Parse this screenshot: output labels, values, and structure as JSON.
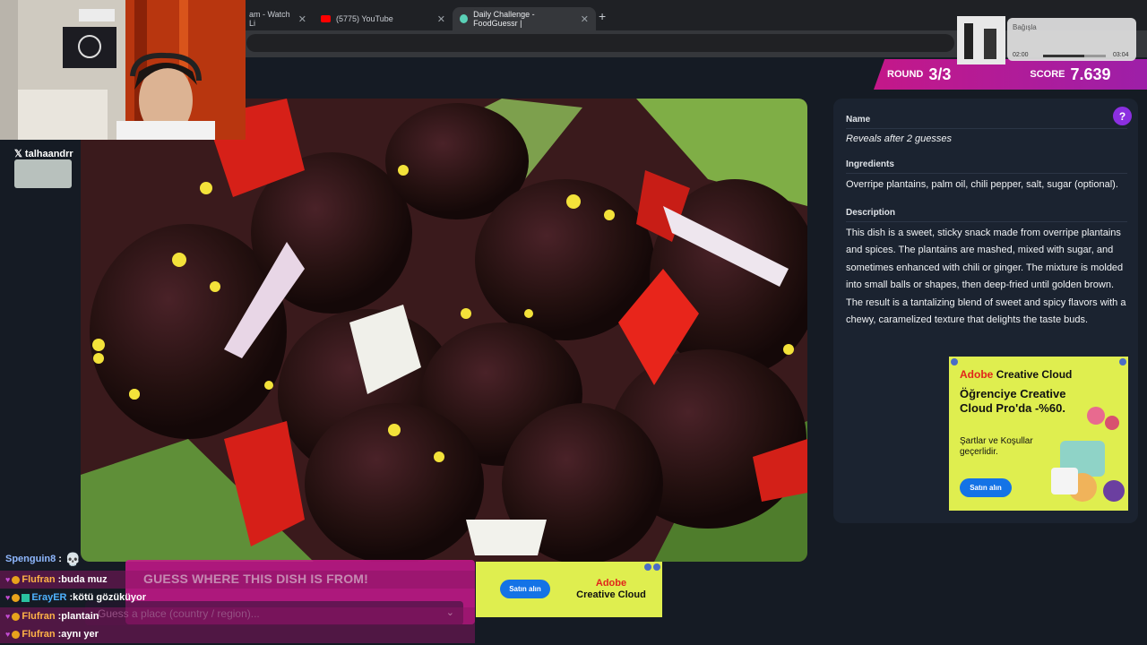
{
  "browser": {
    "tabs": [
      {
        "label": "am - Watch Li"
      },
      {
        "label": "(5775) YouTube"
      },
      {
        "label": "Daily Challenge - FoodGuessr |"
      }
    ],
    "new_tab": "+"
  },
  "header": {
    "round_label": "ROUND",
    "round_value": "3/3",
    "score_label": "SCORE",
    "score_value": "7.639"
  },
  "dish": {
    "description": "Close-up of dark fried plantain balls with red chili and white onion pieces"
  },
  "panel": {
    "help_icon": "?",
    "name_heading": "Name",
    "name_value": "Reveals after 2 guesses",
    "ingredients_heading": "Ingredients",
    "ingredients_value": "Overripe plantains, palm oil, chili pepper, salt, sugar (optional).",
    "description_heading": "Description",
    "description_value": "This dish is a sweet, sticky snack made from overripe plantains and spices. The plantains are mashed, mixed with sugar, and sometimes enhanced with chili or ginger. The mixture is molded into small balls or shapes, then deep-fried until golden brown. The result is a tantalizing blend of sweet and spicy flavors with a chewy, caramelized texture that delights the taste buds."
  },
  "ad": {
    "brand_1": "Adobe",
    "brand_2": "Creative Cloud",
    "offer": "Öğrenciye Creative Cloud Pro'da -%60.",
    "terms": "Şartlar ve Koşullar geçerlidir.",
    "button": "Satın alın"
  },
  "ad2": {
    "button": "Satın alın",
    "brand_1": "Adobe",
    "brand_2": "Creative Cloud"
  },
  "guess": {
    "title": "GUESS WHERE THIS DISH IS FROM!",
    "placeholder": "Guess a place (country / region)..."
  },
  "overlay": {
    "x_handle": "talhaandrr",
    "music_title": "Bağışla",
    "music_current": "02:00",
    "music_length": "03:04",
    "music_progress": 0.65
  },
  "chat": [
    {
      "user": "Spenguin8",
      "message": ""
    },
    {
      "user": "Flufran",
      "message": "buda muz"
    },
    {
      "user": "ErayER",
      "message": "kötü gözüküyor"
    },
    {
      "user": "Flufran",
      "message": "plantain"
    },
    {
      "user": "Flufran",
      "message": "aynı yer"
    }
  ],
  "colors": {
    "accent": "#c41889",
    "panel_bg": "#1b2330",
    "ad_bg": "#dfee4f",
    "ad_button": "#1473e6",
    "help": "#8b2fe0"
  }
}
